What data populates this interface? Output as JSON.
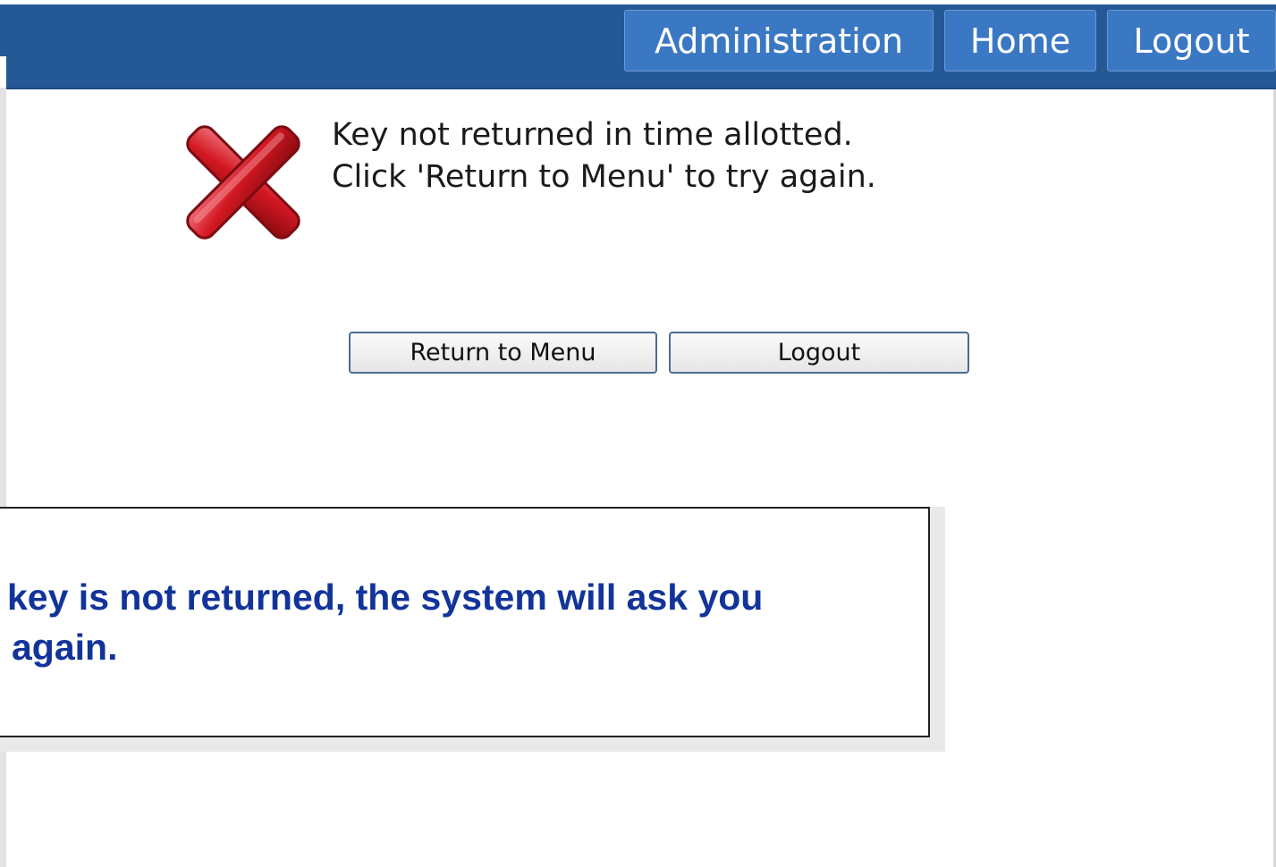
{
  "nav": {
    "administration": "Administration",
    "home": "Home",
    "logout": "Logout"
  },
  "message": {
    "line1": "Key not returned in time allotted.",
    "line2": "Click 'Return to Menu' to try again."
  },
  "icons": {
    "error": "close-x-icon"
  },
  "actions": {
    "return_to_menu": "Return to Menu",
    "logout": "Logout"
  },
  "callout": {
    "line1": "key is not returned, the system will ask you",
    "line2": "again."
  },
  "colors": {
    "header": "#255996",
    "nav_button": "#3b78c4",
    "error_red": "#c8121c",
    "callout_text": "#12349a"
  }
}
